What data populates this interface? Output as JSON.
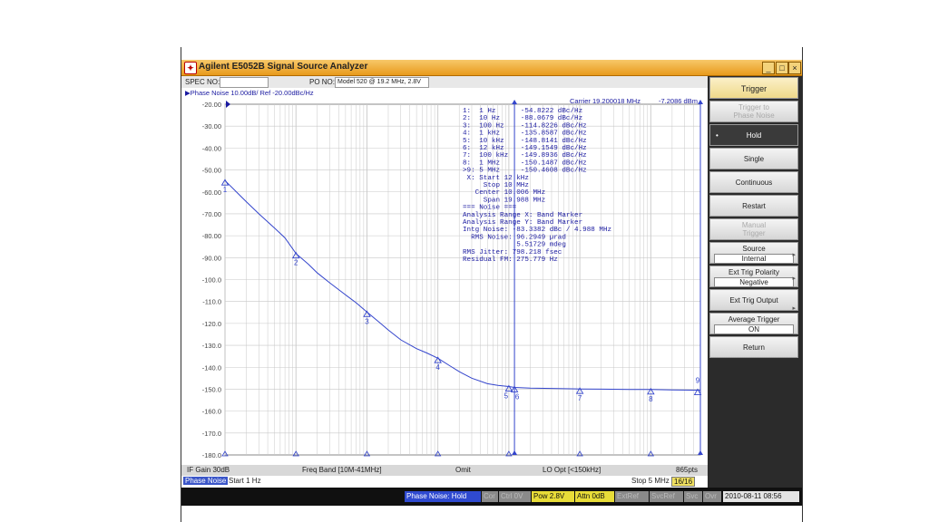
{
  "window": {
    "logo": "✦",
    "title": "Agilent E5052B Signal Source Analyzer",
    "buttons": [
      "_",
      "□",
      "×"
    ]
  },
  "infobar": {
    "spec_label": "SPEC NO:",
    "spec_value": "",
    "po_label": "PO NO:",
    "po_value": "Model 520 @ 19.2 MHz, 2.8V"
  },
  "chart_header": {
    "trace": "▶Phase Noise 10.00dB/ Ref -20.00dBc/Hz",
    "carrier": "Carrier 19.200018 MHz",
    "carrier_power": "-7.2086 dBm"
  },
  "marker_table": [
    "1:  1 Hz      -54.8222 dBc/Hz",
    "2:  10 Hz     -88.0679 dBc/Hz",
    "3:  100 Hz    -114.8226 dBc/Hz",
    "4:  1 kHz     -135.8587 dBc/Hz",
    "5:  10 kHz    -148.8141 dBc/Hz",
    "6:  12 kHz    -149.1549 dBc/Hz",
    "7:  100 kHz   -149.8936 dBc/Hz",
    "8:  1 MHz     -150.1487 dBc/Hz",
    ">9: 5 MHz     -150.4608 dBc/Hz",
    " X: Start 12 kHz",
    "     Stop 10 MHz",
    "   Center 10.006 MHz",
    "     Span 19.988 MHz",
    "=== Noise ===",
    "Analysis Range X: Band Marker",
    "Analysis Range Y: Band Marker",
    "Intg Noise: -83.3382 dBc / 4.988 MHz",
    "  RMS Noise: 96.2949 µrad",
    "             5.51729 mdeg",
    "RMS Jitter: 798.218 fsec",
    "Residual FM: 275.779 Hz"
  ],
  "chart_data": {
    "type": "line",
    "title": "",
    "xlabel": "",
    "ylabel": "",
    "x_scale": "log",
    "xlim": [
      1,
      5000000
    ],
    "ylim": [
      -180,
      -20
    ],
    "ytick_labels": [
      "-20.00",
      "-30.00",
      "-40.00",
      "-50.00",
      "-60.00",
      "-70.00",
      "-80.00",
      "-90.00",
      "-100.0",
      "-110.0",
      "-120.0",
      "-130.0",
      "-140.0",
      "-150.0",
      "-160.0",
      "-170.0",
      "-180.0"
    ],
    "grid": true,
    "series": [
      {
        "x": [
          1,
          1.5,
          2,
          3,
          5,
          7,
          10,
          15,
          20,
          30,
          50,
          70,
          100,
          150,
          200,
          300,
          500,
          700,
          1000,
          1500,
          2000,
          3000,
          5000,
          7000,
          10000,
          12000,
          20000,
          50000,
          100000,
          200000,
          500000,
          1000000,
          2000000,
          5000000
        ],
        "y": [
          -54.8,
          -60.5,
          -64.5,
          -70,
          -76.5,
          -81,
          -88.1,
          -93,
          -97,
          -101.5,
          -107,
          -110.5,
          -114.8,
          -119.5,
          -123,
          -127.5,
          -131.5,
          -133.5,
          -135.9,
          -139.5,
          -142,
          -145,
          -147.5,
          -148.3,
          -148.8,
          -149.2,
          -149.5,
          -149.7,
          -149.9,
          -150,
          -150.1,
          -150.1,
          -150.3,
          -150.5
        ]
      }
    ],
    "markers": [
      {
        "label": "1",
        "x": 1,
        "y": -54.8222
      },
      {
        "label": "2",
        "x": 10,
        "y": -88.0679
      },
      {
        "label": "3",
        "x": 100,
        "y": -114.8226
      },
      {
        "label": "4",
        "x": 1000,
        "y": -135.8587
      },
      {
        "label": "5",
        "x": 10000,
        "y": -148.8141
      },
      {
        "label": "6",
        "x": 12000,
        "y": -149.1549
      },
      {
        "label": "7",
        "x": 100000,
        "y": -149.8936
      },
      {
        "label": "8",
        "x": 1000000,
        "y": -150.1487
      },
      {
        "label": "9",
        "x": 5000000,
        "y": -150.4608
      }
    ],
    "band_markers_x": [
      12000,
      10000000
    ],
    "colors": {
      "trace": "#3344cc",
      "grid": "#c8c8c8",
      "axis_text": "#444444"
    }
  },
  "footer": {
    "if_gain": "IF Gain 30dB",
    "freq_band": "Freq Band [10M-41MHz]",
    "omit": "Omit",
    "lo_opt": "LO Opt [<150kHz]",
    "points": "865pts",
    "tab": "Phase Noise",
    "start": "Start 1 Hz",
    "stop": "Stop 5 MHz",
    "count": "16/16"
  },
  "softkeys": {
    "header": "Trigger",
    "trigger_to": [
      "Trigger to",
      "Phase Noise"
    ],
    "hold": "Hold",
    "single": "Single",
    "continuous": "Continuous",
    "restart": "Restart",
    "manual_trigger": [
      "Manual",
      "Trigger"
    ],
    "source": "Source",
    "source_value": "Internal",
    "ext_polarity": "Ext Trig Polarity",
    "ext_polarity_value": "Negative",
    "ext_output": "Ext Trig Output",
    "avg_trigger": "Average Trigger",
    "avg_trigger_value": "ON",
    "return": "Return"
  },
  "statusbar": {
    "mode": "Phase Noise: Hold",
    "cor": "Cor",
    "ctrl": "Ctrl 0V",
    "pow": "Pow 2.8V",
    "attn": "Attn 0dB",
    "extref": "ExtRef",
    "svcref": "SvcRef",
    "svc": "Svc",
    "ovr": "Ovr",
    "datetime": "2010-08-11 08:56"
  }
}
